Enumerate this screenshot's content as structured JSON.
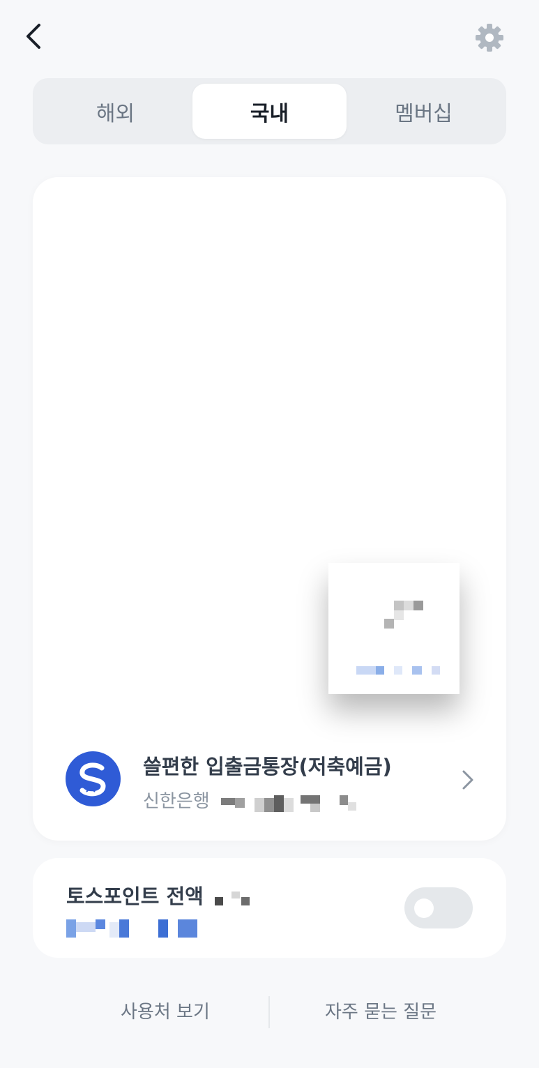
{
  "header": {
    "back_icon": "chevron-left-icon",
    "settings_icon": "gear-icon"
  },
  "tabs": [
    {
      "label": "해외",
      "selected": false
    },
    {
      "label": "국내",
      "selected": true
    },
    {
      "label": "멤버십",
      "selected": false
    }
  ],
  "card": {
    "account_name": "쓸편한 입출금통장(저축예금)",
    "bank_name": "신한은행",
    "bank_icon": "shinhan-bank-logo-icon",
    "chevron_icon": "chevron-right-icon"
  },
  "points": {
    "title": "토스포인트 전액",
    "toggle_on": false
  },
  "footer": {
    "usage_link": "사용처 보기",
    "faq_link": "자주 묻는 질문"
  },
  "colors": {
    "background": "#f7f8fa",
    "accent_blue": "#2f5bd6",
    "text_primary": "#191f28",
    "text_secondary": "#6b7684"
  }
}
